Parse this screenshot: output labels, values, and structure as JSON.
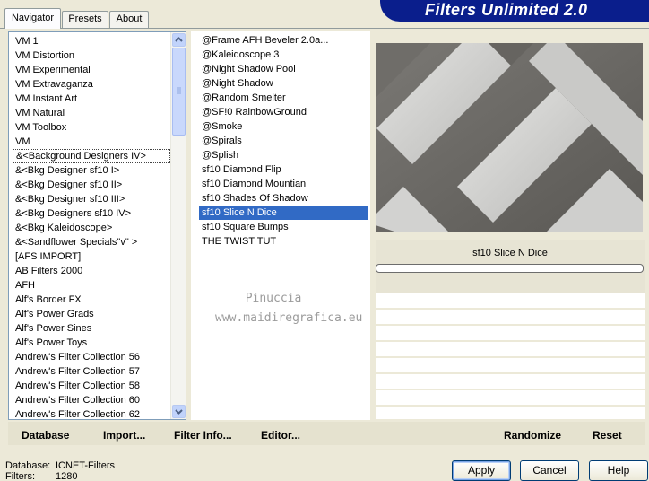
{
  "header": {
    "title": "Filters Unlimited 2.0"
  },
  "tabs": [
    {
      "label": "Navigator",
      "active": true
    },
    {
      "label": "Presets",
      "active": false
    },
    {
      "label": "About",
      "active": false
    }
  ],
  "categories": [
    "VM 1",
    "VM Distortion",
    "VM Experimental",
    "VM Extravaganza",
    "VM Instant Art",
    "VM Natural",
    "VM Toolbox",
    "VM",
    "&<Background Designers IV>",
    "&<Bkg Designer sf10 I>",
    "&<Bkg Designer sf10 II>",
    "&<Bkg Designer sf10 III>",
    "&<Bkg Designers sf10 IV>",
    "&<Bkg Kaleidoscope>",
    "&<Sandflower Specials\"v\" >",
    "[AFS IMPORT]",
    "AB Filters 2000",
    "AFH",
    "Alf's Border FX",
    "Alf's Power Grads",
    "Alf's Power Sines",
    "Alf's Power Toys",
    "Andrew's Filter Collection 56",
    "Andrew's Filter Collection 57",
    "Andrew's Filter Collection 58",
    "Andrew's Filter Collection 60",
    "Andrew's Filter Collection 62"
  ],
  "focused_category_index": 8,
  "filters": [
    "@Frame AFH Beveler 2.0a...",
    "@Kaleidoscope 3",
    "@Night Shadow Pool",
    "@Night Shadow",
    "@Random Smelter",
    "@SF!0 RainbowGround",
    "@Smoke",
    "@Spirals",
    "@Splish",
    "sf10 Diamond Flip",
    "sf10 Diamond Mountian",
    "sf10 Shades Of Shadow",
    "sf10 Slice N Dice",
    "sf10 Square Bumps",
    "THE TWIST TUT"
  ],
  "selected_filter_index": 12,
  "preview": {
    "filter_name": "sf10 Slice N Dice",
    "progress_fraction": 0
  },
  "watermark": {
    "line1": "Pinuccia",
    "line2": "www.maidiregrafica.eu"
  },
  "bottom_bar": {
    "database": "Database",
    "import": "Import...",
    "filter_info": "Filter Info...",
    "editor": "Editor...",
    "randomize": "Randomize",
    "reset": "Reset"
  },
  "status": {
    "database_label": "Database:",
    "database_value": "ICNET-Filters",
    "filters_label": "Filters:",
    "filters_value": "1280"
  },
  "buttons": {
    "apply": "Apply",
    "cancel": "Cancel",
    "help": "Help"
  },
  "colors": {
    "banner": "#0a1e8c",
    "selection": "#316ac5",
    "dialog_bg": "#ece9d8"
  }
}
